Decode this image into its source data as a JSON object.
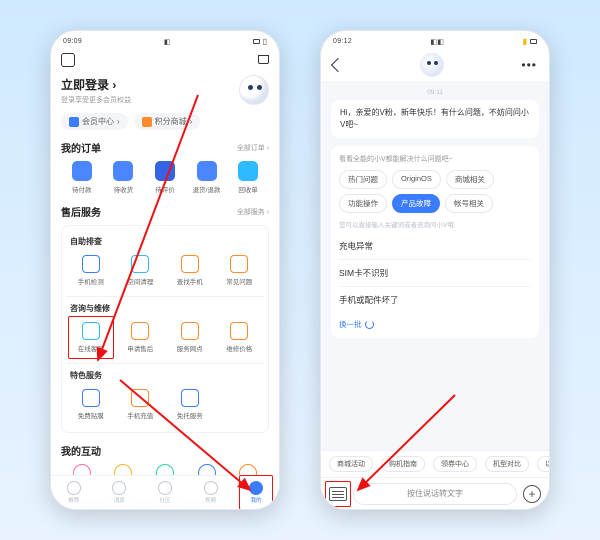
{
  "phone1": {
    "status_time": "09:09",
    "login_title": "立即登录",
    "login_sub": "登录享受更多会员权益",
    "pills": {
      "member": "会员中心",
      "points": "积分商城"
    },
    "orders": {
      "head": "我的订单",
      "more": "全部订单 ›",
      "items": [
        "待付款",
        "待收货",
        "待评价",
        "退货/退款",
        "回收单"
      ]
    },
    "service": {
      "head": "售后服务",
      "more": "全部服务 ›",
      "g1": {
        "head": "自助排查",
        "items": [
          "手机检测",
          "空间清理",
          "查找手机",
          "常见问题"
        ]
      },
      "g2": {
        "head": "咨询与维修",
        "items": [
          "在线客服",
          "申请售后",
          "服务网点",
          "维修价格"
        ]
      },
      "g3": {
        "head": "特色服务",
        "items": [
          "免费贴膜",
          "手机充值",
          "免托服务"
        ]
      }
    },
    "interact_head": "我的互动",
    "nav": [
      "推荐",
      "消息",
      "社区",
      "视频",
      "我的"
    ]
  },
  "phone2": {
    "status_time": "09:12",
    "timestamp": "09:11",
    "greeting": "Hi，亲爱的V粉，新年快乐！有什么问题，不妨问问小V吧~",
    "card_head": "看看全能的小V都能解决什么问题吧~",
    "chips": [
      "热门问题",
      "OriginOS",
      "商城相关",
      "功能操作",
      "产品故障",
      "帐号相关"
    ],
    "active_chip": "产品故障",
    "faq_hint": "您可以直接输入关键词或者咨询问小V哦",
    "faq": [
      "充电异常",
      "SIM卡不识别",
      "手机或配件坏了"
    ],
    "refresh": "换一批",
    "tags": [
      "商城活动",
      "购机指南",
      "领券中心",
      "机型对比",
      "以"
    ],
    "voice_placeholder": "按住说话转文字"
  }
}
